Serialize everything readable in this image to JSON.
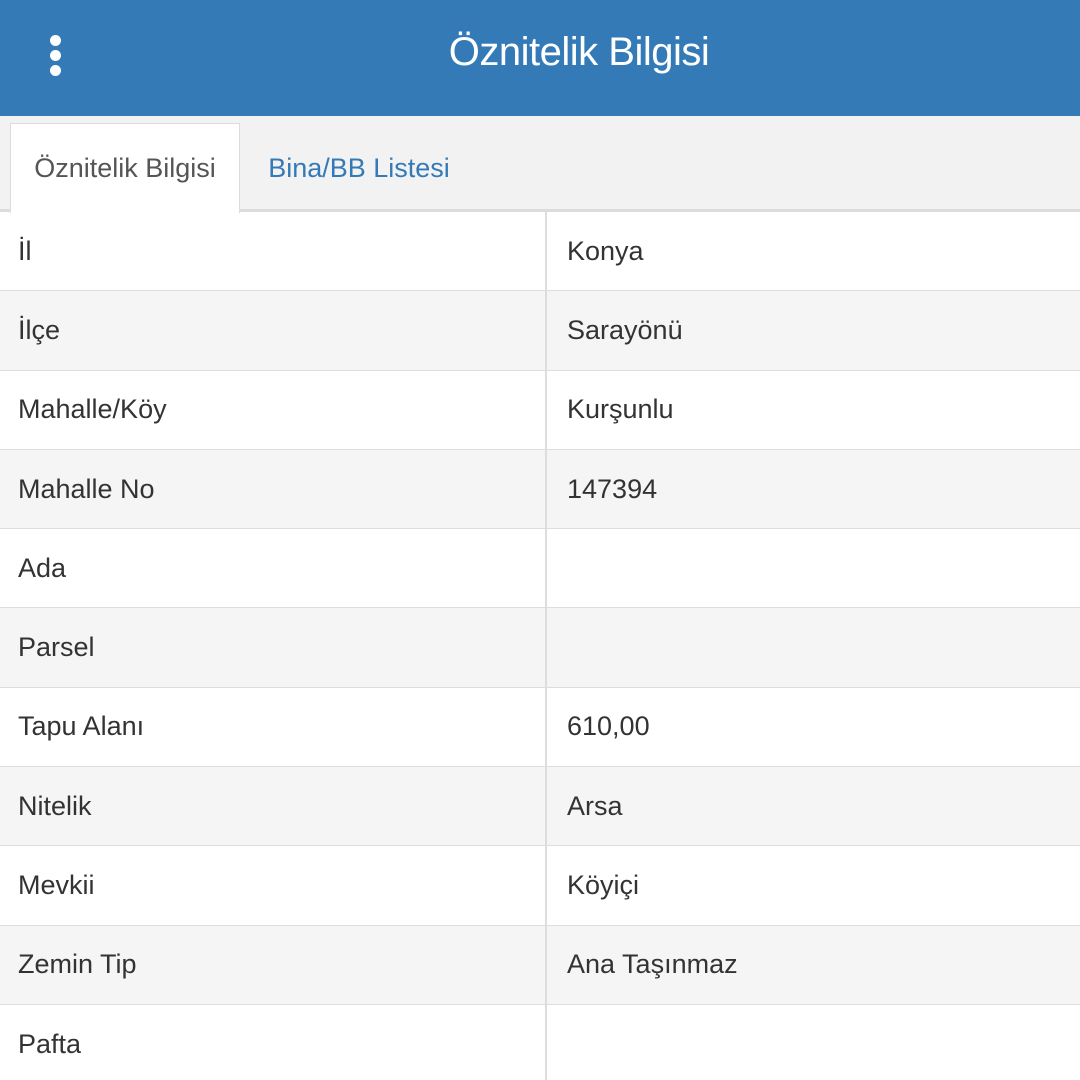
{
  "header": {
    "title": "Öznitelik Bilgisi",
    "menu_icon": "vertical-ellipsis-icon"
  },
  "tabs": [
    {
      "label": "Öznitelik Bilgisi",
      "active": true
    },
    {
      "label": "Bina/BB Listesi",
      "active": false
    }
  ],
  "attributes": [
    {
      "key": "İl",
      "value": "Konya"
    },
    {
      "key": "İlçe",
      "value": "Sarayönü"
    },
    {
      "key": "Mahalle/Köy",
      "value": "Kurşunlu"
    },
    {
      "key": "Mahalle No",
      "value": "147394"
    },
    {
      "key": "Ada",
      "value": ""
    },
    {
      "key": "Parsel",
      "value": ""
    },
    {
      "key": "Tapu Alanı",
      "value": "610,00"
    },
    {
      "key": "Nitelik",
      "value": "Arsa"
    },
    {
      "key": "Mevkii",
      "value": "Köyiçi"
    },
    {
      "key": "Zemin Tip",
      "value": "Ana Taşınmaz"
    },
    {
      "key": "Pafta",
      "value": ""
    }
  ],
  "colors": {
    "header_bg": "#337ab7",
    "link": "#337ab7",
    "row_alt": "#f5f5f5",
    "border": "#dddddd"
  }
}
